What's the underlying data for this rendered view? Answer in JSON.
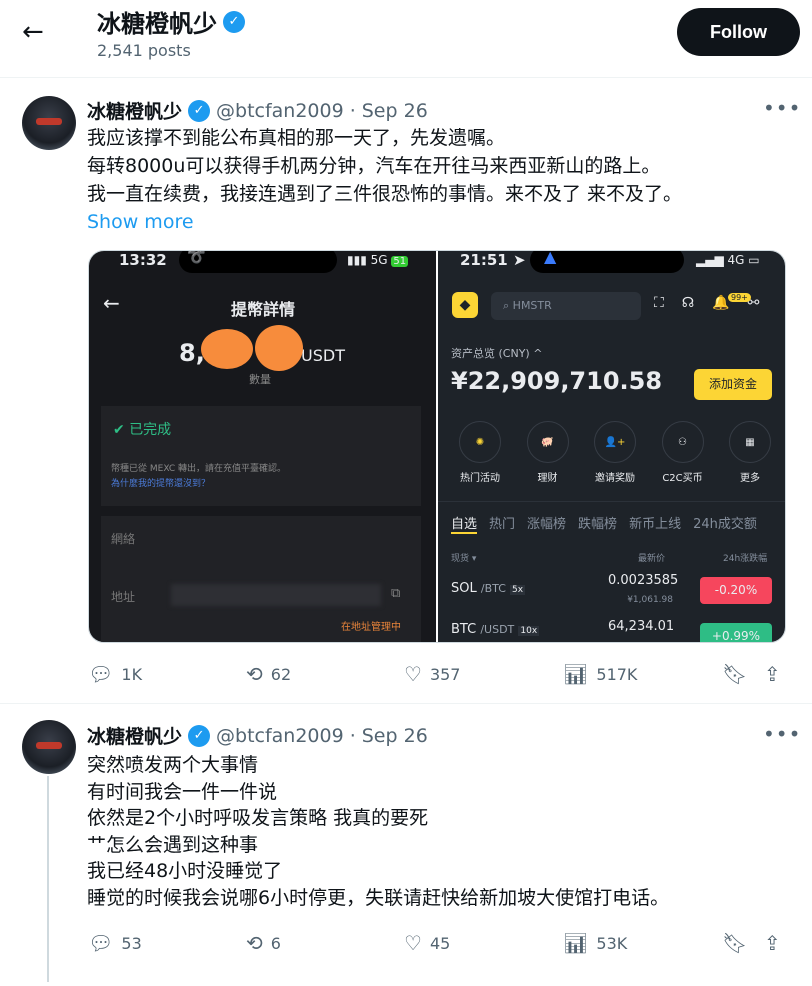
{
  "header": {
    "back_icon": "arrow-left-icon",
    "name": "冰糖橙帆少",
    "posts": "2,541 posts",
    "follow": "Follow"
  },
  "tweets": [
    {
      "name": "冰糖橙帆少",
      "handle": "@btcfan2009",
      "date": "Sep 26",
      "lines": [
        "我应该撑不到能公布真相的那一天了，先发遗嘱。",
        "每转8000u可以获得手机两分钟，汽车在开往马来西亚新山的路上。",
        "我一直在续费，我接连遇到了三件很恐怖的事情。来不及了 来不及了。"
      ],
      "show_more": "Show more",
      "replies": "1K",
      "reposts": "62",
      "likes": "357",
      "views": "517K"
    },
    {
      "name": "冰糖橙帆少",
      "handle": "@btcfan2009",
      "date": "Sep 26",
      "lines": [
        "突然喷发两个大事情",
        "有时间我会一件一件说",
        "依然是2个小时呼吸发言策略 我真的要死",
        "艹怎么会遇到这种事",
        "我已经48小时没睡觉了",
        "睡觉的时候我会说哪6小时停更，失联请赶快给新加坡大使馆打电话。"
      ],
      "replies": "53",
      "reposts": "6",
      "likes": "45",
      "views": "53K"
    }
  ],
  "img1": {
    "time": "13:32",
    "signal": "5G",
    "battery": "51",
    "title": "提幣詳情",
    "amount_prefix": "8,",
    "amount_suffix": "USDT",
    "amount_label": "數量",
    "status": "已完成",
    "note": "幣種已從 MEXC 轉出，請在充值平臺確認。",
    "link": "為什麼我的提幣還沒到？",
    "network_label": "網絡",
    "address_label": "地址",
    "addr_note": "在地址管理中"
  },
  "img2": {
    "time": "21:51",
    "signal": "4G",
    "search": "HMSTR",
    "badge": "99+",
    "assets_label": "资产总览 (CNY) ^",
    "balance": "¥22,909,710.58",
    "add_funds": "添加资金",
    "shortcuts": [
      "热门活动",
      "理财",
      "邀请奖励",
      "C2C买币",
      "更多"
    ],
    "tabs": [
      "自选",
      "热门",
      "涨幅榜",
      "跌幅榜",
      "新币上线",
      "24h成交额"
    ],
    "col_spot": "现货 ▾",
    "col_price": "最新价",
    "col_change": "24h涨跌幅",
    "rows": [
      {
        "sym": "SOL",
        "quote": "/BTC",
        "lev": "5x",
        "price": "0.0023585",
        "fiat": "¥1,061.98",
        "change": "-0.20%"
      },
      {
        "sym": "BTC",
        "quote": "/USDT",
        "lev": "10x",
        "price": "64,234.01",
        "change": "+0.99%"
      }
    ]
  },
  "colors": {
    "accent": "#1d9bf0",
    "binance_yellow": "#fcd535",
    "red": "#f6465d",
    "green": "#2ebd85"
  }
}
